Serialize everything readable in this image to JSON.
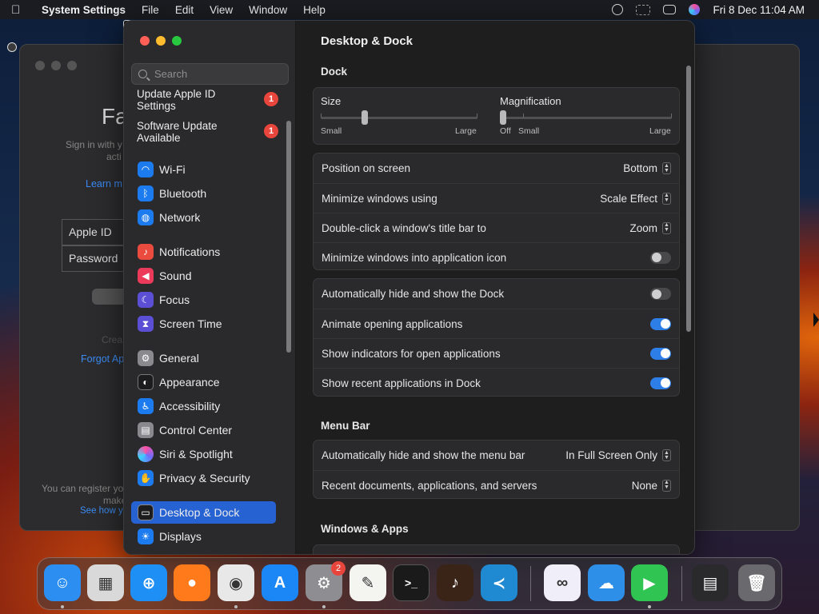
{
  "menubar": {
    "app_name": "System Settings",
    "menus": [
      "File",
      "Edit",
      "View",
      "Window",
      "Help"
    ],
    "datetime": "Fri 8 Dec  11:04 AM"
  },
  "background_window": {
    "big_text": "Fa",
    "sign_in_text_1": "Sign in with y",
    "sign_in_text_2": "acti",
    "learn_more": "Learn m",
    "apple_id_label": "Apple ID",
    "password_label": "Password",
    "create_text": "Crea",
    "forgot_text": "Forgot Ap",
    "register_text_1": "You can register yo",
    "register_text_2": "make",
    "see_how": "See how y"
  },
  "sidebar": {
    "search_placeholder": "Search",
    "update_apple_id": "Update Apple ID Settings",
    "update_apple_id_badge": "1",
    "software_update": "Software Update Available",
    "software_update_badge": "1",
    "items": [
      {
        "label": "Wi-Fi",
        "icon": "wifi-icon",
        "color": "#1d7bf0"
      },
      {
        "label": "Bluetooth",
        "icon": "bluetooth-icon",
        "color": "#1d7bf0"
      },
      {
        "label": "Network",
        "icon": "globe-icon",
        "color": "#1d7bf0"
      },
      {
        "label": "Notifications",
        "icon": "bell-icon",
        "color": "#eb4b3f"
      },
      {
        "label": "Sound",
        "icon": "speaker-icon",
        "color": "#eb3a5a"
      },
      {
        "label": "Focus",
        "icon": "moon-icon",
        "color": "#5b4fd6"
      },
      {
        "label": "Screen Time",
        "icon": "hourglass-icon",
        "color": "#5b4fd6"
      },
      {
        "label": "General",
        "icon": "gear-icon",
        "color": "#8a8a8e"
      },
      {
        "label": "Appearance",
        "icon": "appearance-icon",
        "color": "#1c1c1e"
      },
      {
        "label": "Accessibility",
        "icon": "accessibility-icon",
        "color": "#1d7bf0"
      },
      {
        "label": "Control Center",
        "icon": "control-center-icon",
        "color": "#8a8a8e"
      },
      {
        "label": "Siri & Spotlight",
        "icon": "siri-icon",
        "color": "#a044d8"
      },
      {
        "label": "Privacy & Security",
        "icon": "hand-icon",
        "color": "#1d7bf0"
      },
      {
        "label": "Desktop & Dock",
        "icon": "dock-icon",
        "color": "#1c1c1e"
      },
      {
        "label": "Displays",
        "icon": "display-icon",
        "color": "#1d7bf0"
      }
    ],
    "selected": "Desktop & Dock"
  },
  "content": {
    "title": "Desktop & Dock",
    "dock_section": "Dock",
    "size_label": "Size",
    "size_small": "Small",
    "size_large": "Large",
    "size_value": 0.28,
    "magnification_label": "Magnification",
    "mag_off": "Off",
    "mag_small": "Small",
    "mag_large": "Large",
    "mag_value": 0.0,
    "position_label": "Position on screen",
    "position_value": "Bottom",
    "minimize_label": "Minimize windows using",
    "minimize_value": "Scale Effect",
    "doubleclick_label": "Double-click a window's title bar to",
    "doubleclick_value": "Zoom",
    "minimize_into_label": "Minimize windows into application icon",
    "minimize_into_on": false,
    "autohide_label": "Automatically hide and show the Dock",
    "autohide_on": false,
    "animate_label": "Animate opening applications",
    "animate_on": true,
    "indicators_label": "Show indicators for open applications",
    "indicators_on": true,
    "recent_apps_label": "Show recent applications in Dock",
    "recent_apps_on": true,
    "menubar_section": "Menu Bar",
    "menubar_autohide_label": "Automatically hide and show the menu bar",
    "menubar_autohide_value": "In Full Screen Only",
    "recent_docs_label": "Recent documents, applications, and servers",
    "recent_docs_value": "None",
    "windows_section": "Windows & Apps"
  },
  "dock": {
    "apps": [
      {
        "name": "Finder",
        "icon": "finder-icon",
        "color": "#2b8ef0",
        "glyph": "☺",
        "running": true
      },
      {
        "name": "Launchpad",
        "icon": "launchpad-icon",
        "color": "#d9d9d9",
        "glyph": "▦",
        "running": false
      },
      {
        "name": "Safari",
        "icon": "safari-icon",
        "color": "#1e8ff5",
        "glyph": "⊕",
        "running": false
      },
      {
        "name": "Firefox",
        "icon": "firefox-icon",
        "color": "#ff7a1a",
        "glyph": "●",
        "running": false
      },
      {
        "name": "Chrome",
        "icon": "chrome-icon",
        "color": "#e8e8e8",
        "glyph": "◉",
        "running": true
      },
      {
        "name": "App Store",
        "icon": "app-store-icon",
        "color": "#1b86f5",
        "glyph": "A",
        "running": false
      },
      {
        "name": "System Settings",
        "icon": "system-settings-icon",
        "color": "#8d8d92",
        "glyph": "⚙",
        "running": true,
        "badge": "2"
      },
      {
        "name": "TextEdit",
        "icon": "textedit-icon",
        "color": "#f4f4f0",
        "glyph": "✎",
        "running": false
      },
      {
        "name": "Terminal",
        "icon": "terminal-icon",
        "color": "#1a1a1a",
        "glyph": ">_",
        "running": false
      },
      {
        "name": "GarageBand",
        "icon": "garageband-icon",
        "color": "#3a2418",
        "glyph": "♪",
        "running": false
      },
      {
        "name": "VS Code",
        "icon": "vscode-icon",
        "color": "#1f8ad2",
        "glyph": "≺",
        "running": false
      },
      {
        "name": "Visual Studio",
        "icon": "visual-studio-icon",
        "color": "#f0eef8",
        "glyph": "∞",
        "running": false
      },
      {
        "name": "Weather",
        "icon": "weather-icon",
        "color": "#2e8fe8",
        "glyph": "☁",
        "running": false
      },
      {
        "name": "FaceTime",
        "icon": "facetime-icon",
        "color": "#30c452",
        "glyph": "▶",
        "running": true
      },
      {
        "name": "Downloads",
        "icon": "downloads-stack-icon",
        "color": "#2a2a2c",
        "glyph": "▤",
        "running": false
      },
      {
        "name": "Trash",
        "icon": "trash-icon",
        "color": "#6a6a6e",
        "glyph": "🗑",
        "running": false
      }
    ]
  }
}
